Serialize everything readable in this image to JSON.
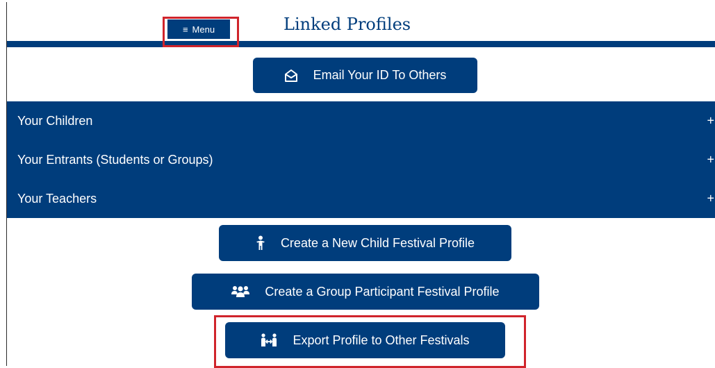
{
  "header": {
    "menu_label": "Menu",
    "menu_icon_glyph": "≡",
    "title": "Linked Profiles"
  },
  "actions": {
    "email_label": "Email Your ID To Others",
    "create_child_label": "Create a New Child Festival Profile",
    "create_group_label": "Create a Group Participant Festival Profile",
    "export_label": "Export Profile to Other Festivals"
  },
  "accordion": {
    "items": [
      {
        "label": "Your Children",
        "toggle": "+"
      },
      {
        "label": "Your Entrants (Students or Groups)",
        "toggle": "+"
      },
      {
        "label": "Your Teachers",
        "toggle": "+"
      }
    ]
  },
  "icons": {
    "menu": "hamburger-icon",
    "email": "envelope-open-icon",
    "child": "child-icon",
    "group": "users-icon",
    "export": "people-arrows-icon"
  },
  "colors": {
    "primary": "#003d7c",
    "text_on_primary": "#ffffff",
    "highlight": "#d0242b"
  }
}
